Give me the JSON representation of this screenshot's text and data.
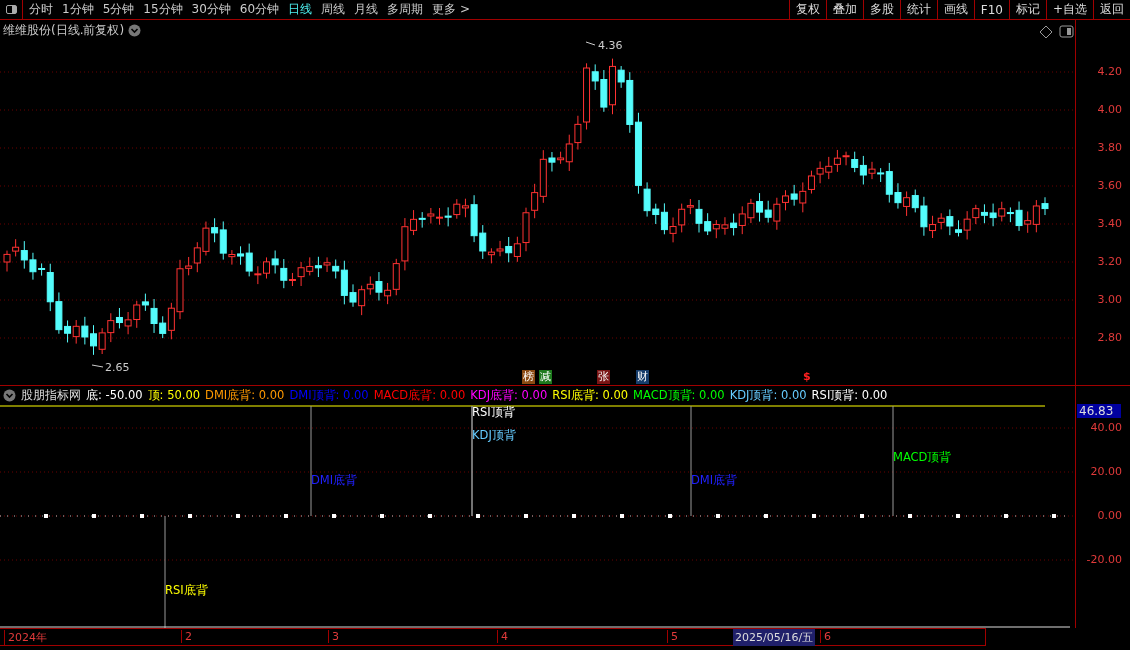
{
  "toolbar": {
    "periods": [
      {
        "label": "分时",
        "selected": false
      },
      {
        "label": "1分钟",
        "selected": false
      },
      {
        "label": "5分钟",
        "selected": false
      },
      {
        "label": "15分钟",
        "selected": false
      },
      {
        "label": "30分钟",
        "selected": false
      },
      {
        "label": "60分钟",
        "selected": false
      },
      {
        "label": "日线",
        "selected": true
      },
      {
        "label": "周线",
        "selected": false
      },
      {
        "label": "月线",
        "selected": false
      },
      {
        "label": "多周期",
        "selected": false
      },
      {
        "label": "更多 >",
        "selected": false
      }
    ],
    "actions": [
      "复权",
      "叠加",
      "多股",
      "统计",
      "画线",
      "F10",
      "标记",
      "+自选",
      "返回"
    ]
  },
  "main_chart": {
    "title": "维维股份(日线.前复权)",
    "high_label": "4.36",
    "low_label": "2.65",
    "y_axis": [
      "4.20",
      "4.00",
      "3.80",
      "3.60",
      "3.40",
      "3.20",
      "3.00",
      "2.80"
    ],
    "event_tags": [
      {
        "label": "榜",
        "color": "#8b4a12"
      },
      {
        "label": "减",
        "color": "#1d7a1d"
      },
      {
        "label": "张",
        "color": "#7a1414"
      },
      {
        "label": "财",
        "color": "#163d6b"
      },
      {
        "label": "$",
        "color": "#000000"
      }
    ]
  },
  "indicator": {
    "name": "股朋指标网",
    "params": [
      {
        "label": "底: -50.00",
        "color": "#ffffff"
      },
      {
        "label": "顶: 50.00",
        "color": "#ffff00"
      },
      {
        "label": "DMI底背: 0.00",
        "color": "#ff9900"
      },
      {
        "label": "DMI顶背: 0.00",
        "color": "#0000ff"
      },
      {
        "label": "MACD底背: 0.00",
        "color": "#ff0000"
      },
      {
        "label": "KDJ底背: 0.00",
        "color": "#ff00ff"
      },
      {
        "label": "RSI底背: 0.00",
        "color": "#ffff00"
      },
      {
        "label": "MACD顶背: 0.00",
        "color": "#00ff00"
      },
      {
        "label": "KDJ顶背: 0.00",
        "color": "#66ccff"
      },
      {
        "label": "RSI顶背: 0.00",
        "color": "#ffffff"
      }
    ],
    "current_value": "46.83",
    "y_axis": [
      "40.00",
      "20.00",
      "0.00",
      "-20.00"
    ],
    "signals": [
      {
        "label": "RSI底背",
        "color": "#ffff00",
        "kind": "bottom"
      },
      {
        "label": "DMI底背",
        "color": "#2020ff",
        "kind": "top"
      },
      {
        "label": "RSI顶背",
        "color": "#ffffff",
        "kind": "top"
      },
      {
        "label": "KDJ顶背",
        "color": "#66ccff",
        "kind": "top"
      },
      {
        "label": "DMI底背",
        "color": "#2020ff",
        "kind": "top"
      },
      {
        "label": "MACD顶背",
        "color": "#00ff00",
        "kind": "top"
      }
    ]
  },
  "time_axis": {
    "labels": [
      "2024年",
      "2",
      "3",
      "4",
      "5",
      "6"
    ],
    "cursor_date": "2025/05/16/五"
  }
}
